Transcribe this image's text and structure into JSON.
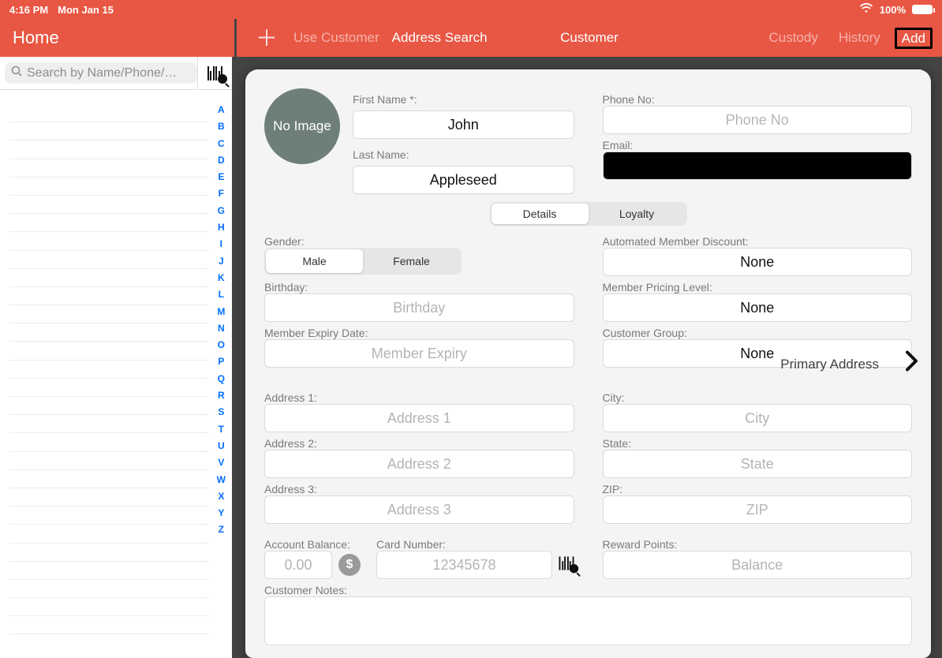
{
  "status": {
    "time": "4:16 PM",
    "date": "Mon Jan 15",
    "battery": "100%"
  },
  "nav": {
    "home": "Home",
    "use_customer": "Use Customer",
    "address_search": "Address Search",
    "title": "Customer",
    "custody": "Custody",
    "history": "History",
    "add": "Add"
  },
  "sidebar": {
    "search_placeholder": "Search by Name/Phone/…",
    "index": [
      "A",
      "B",
      "C",
      "D",
      "E",
      "F",
      "G",
      "H",
      "I",
      "J",
      "K",
      "L",
      "M",
      "N",
      "O",
      "P",
      "Q",
      "R",
      "S",
      "T",
      "U",
      "V",
      "W",
      "X",
      "Y",
      "Z"
    ]
  },
  "form": {
    "avatar": "No Image",
    "first_name_label": "First Name *:",
    "first_name": "John",
    "last_name_label": "Last Name:",
    "last_name": "Appleseed",
    "phone_label": "Phone No:",
    "phone_ph": "Phone No",
    "email_label": "Email:",
    "tabs": {
      "details": "Details",
      "loyalty": "Loyalty"
    },
    "gender_label": "Gender:",
    "gender_male": "Male",
    "gender_female": "Female",
    "discount_label": "Automated Member Discount:",
    "discount_value": "None",
    "birthday_label": "Birthday:",
    "birthday_ph": "Birthday",
    "pricing_label": "Member Pricing Level:",
    "pricing_value": "None",
    "expiry_label": "Member Expiry Date:",
    "expiry_ph": "Member Expiry",
    "group_label": "Customer Group:",
    "group_value": "None",
    "primary_address": "Primary Address",
    "addr1_label": "Address 1:",
    "addr1_ph": "Address 1",
    "city_label": "City:",
    "city_ph": "City",
    "addr2_label": "Address 2:",
    "addr2_ph": "Address 2",
    "state_label": "State:",
    "state_ph": "State",
    "addr3_label": "Address 3:",
    "addr3_ph": "Address 3",
    "zip_label": "ZIP:",
    "zip_ph": "ZIP",
    "balance_label": "Account Balance:",
    "balance_ph": "0.00",
    "card_label": "Card Number:",
    "card_ph": "12345678",
    "reward_label": "Reward Points:",
    "reward_ph": "Balance",
    "notes_label": "Customer Notes:"
  }
}
